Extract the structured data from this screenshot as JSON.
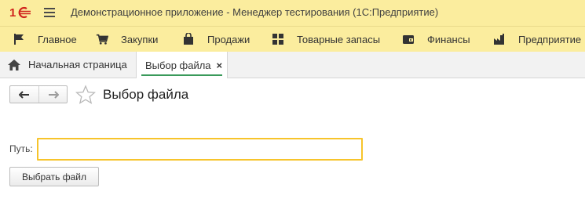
{
  "titlebar": {
    "logo_text": "1С",
    "title": "Демонстрационное приложение  - Менеджер тестирования (1С:Предприятие)",
    "background": "#fbed9e"
  },
  "menubar": {
    "items": [
      {
        "label": "Главное",
        "icon": "flag-icon"
      },
      {
        "label": "Закупки",
        "icon": "cart-icon"
      },
      {
        "label": "Продажи",
        "icon": "bag-icon"
      },
      {
        "label": "Товарные запасы",
        "icon": "grid-icon"
      },
      {
        "label": "Финансы",
        "icon": "wallet-icon"
      },
      {
        "label": "Предприятие",
        "icon": "factory-icon"
      }
    ]
  },
  "tabs": {
    "home_label": "Начальная страница",
    "active_label": "Выбор файла",
    "close_glyph": "×",
    "active_underline_color": "#3a9a5b"
  },
  "form": {
    "title": "Выбор файла",
    "path_label": "Путь:",
    "path_value": "",
    "choose_button": "Выбрать файл",
    "input_border_color": "#f7c42b"
  }
}
